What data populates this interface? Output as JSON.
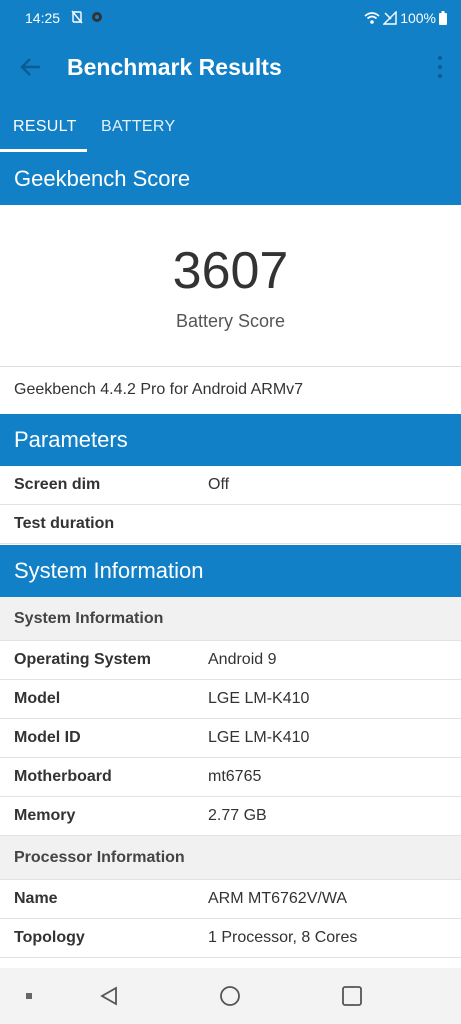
{
  "status_bar": {
    "time": "14:25",
    "battery": "100%"
  },
  "app_bar": {
    "title": "Benchmark Results"
  },
  "tabs": [
    {
      "label": "RESULT",
      "selected": true
    },
    {
      "label": "BATTERY",
      "selected": false
    }
  ],
  "geekbench": {
    "header": "Geekbench Score",
    "score": "3607",
    "score_label": "Battery Score",
    "version": "Geekbench 4.4.2 Pro for Android ARMv7"
  },
  "parameters": {
    "header": "Parameters",
    "rows": [
      {
        "key": "Screen dim",
        "value": "Off"
      },
      {
        "key": "Test duration",
        "value": ""
      }
    ]
  },
  "system_info": {
    "header": "System Information",
    "subheader": "System Information",
    "rows": [
      {
        "key": "Operating System",
        "value": "Android 9"
      },
      {
        "key": "Model",
        "value": "LGE LM-K410"
      },
      {
        "key": "Model ID",
        "value": "LGE LM-K410"
      },
      {
        "key": "Motherboard",
        "value": "mt6765"
      },
      {
        "key": "Memory",
        "value": "2.77 GB"
      }
    ],
    "processor_subheader": "Processor Information",
    "processor_rows": [
      {
        "key": "Name",
        "value": "ARM MT6762V/WA"
      },
      {
        "key": "Topology",
        "value": "1 Processor, 8 Cores"
      }
    ]
  },
  "colors": {
    "primary": "#1180c7",
    "subheader_bg": "#f1f1f1"
  },
  "icons": {
    "back": "arrow-left-icon",
    "more": "more-vert-icon",
    "nav_back": "triangle-back-icon",
    "nav_home": "circle-home-icon",
    "nav_recents": "square-recents-icon"
  }
}
